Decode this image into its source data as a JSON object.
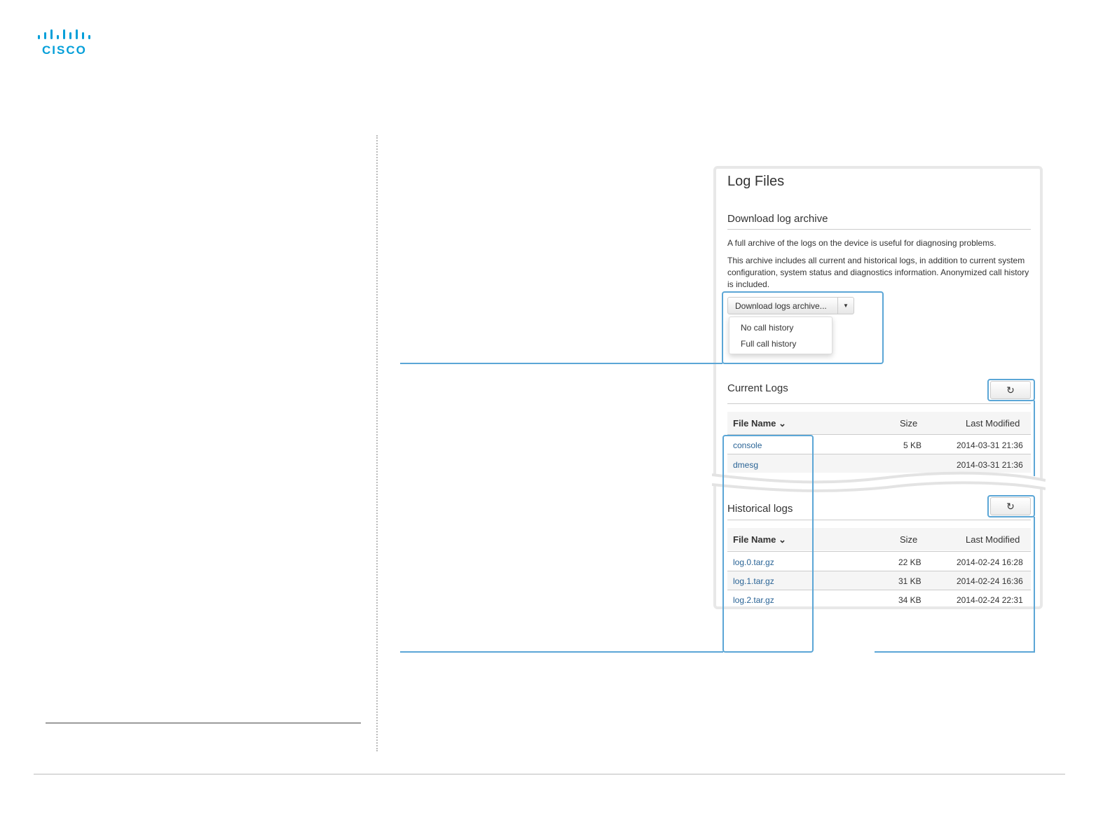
{
  "brand": {
    "logo_text": "CISCO",
    "logo_color": "#049fd9"
  },
  "panel": {
    "title": "Log Files",
    "download_section": {
      "heading": "Download log archive",
      "para1": "A full archive of the logs on the device is useful for diagnosing problems.",
      "para2": "This archive includes all current and historical logs, in addition to current system configuration, system status and diagnostics information. Anonymized call history is included.",
      "button_label": "Download logs archive...",
      "menu_items": [
        "No call history",
        "Full call history"
      ]
    },
    "current_logs": {
      "heading": "Current Logs",
      "columns": [
        "File Name",
        "Size",
        "Last Modified"
      ],
      "rows": [
        {
          "name": "console",
          "size": "5 KB",
          "modified": "2014-03-31 21:36"
        },
        {
          "name": "dmesg",
          "size": "",
          "modified": "2014-03-31 21:36"
        }
      ]
    },
    "historical_logs": {
      "heading": "Historical logs",
      "columns": [
        "File Name",
        "Size",
        "Last Modified"
      ],
      "rows": [
        {
          "name": "log.0.tar.gz",
          "size": "22 KB",
          "modified": "2014-02-24 16:28"
        },
        {
          "name": "log.1.tar.gz",
          "size": "31 KB",
          "modified": "2014-02-24 16:36"
        },
        {
          "name": "log.2.tar.gz",
          "size": "34 KB",
          "modified": "2014-02-24 22:31"
        }
      ]
    }
  },
  "icons": {
    "refresh": "refresh-icon",
    "sort": "chevron-down-icon",
    "caret": "caret-down-icon"
  },
  "colors": {
    "callout": "#5ba6d6",
    "link": "#2a6496"
  }
}
